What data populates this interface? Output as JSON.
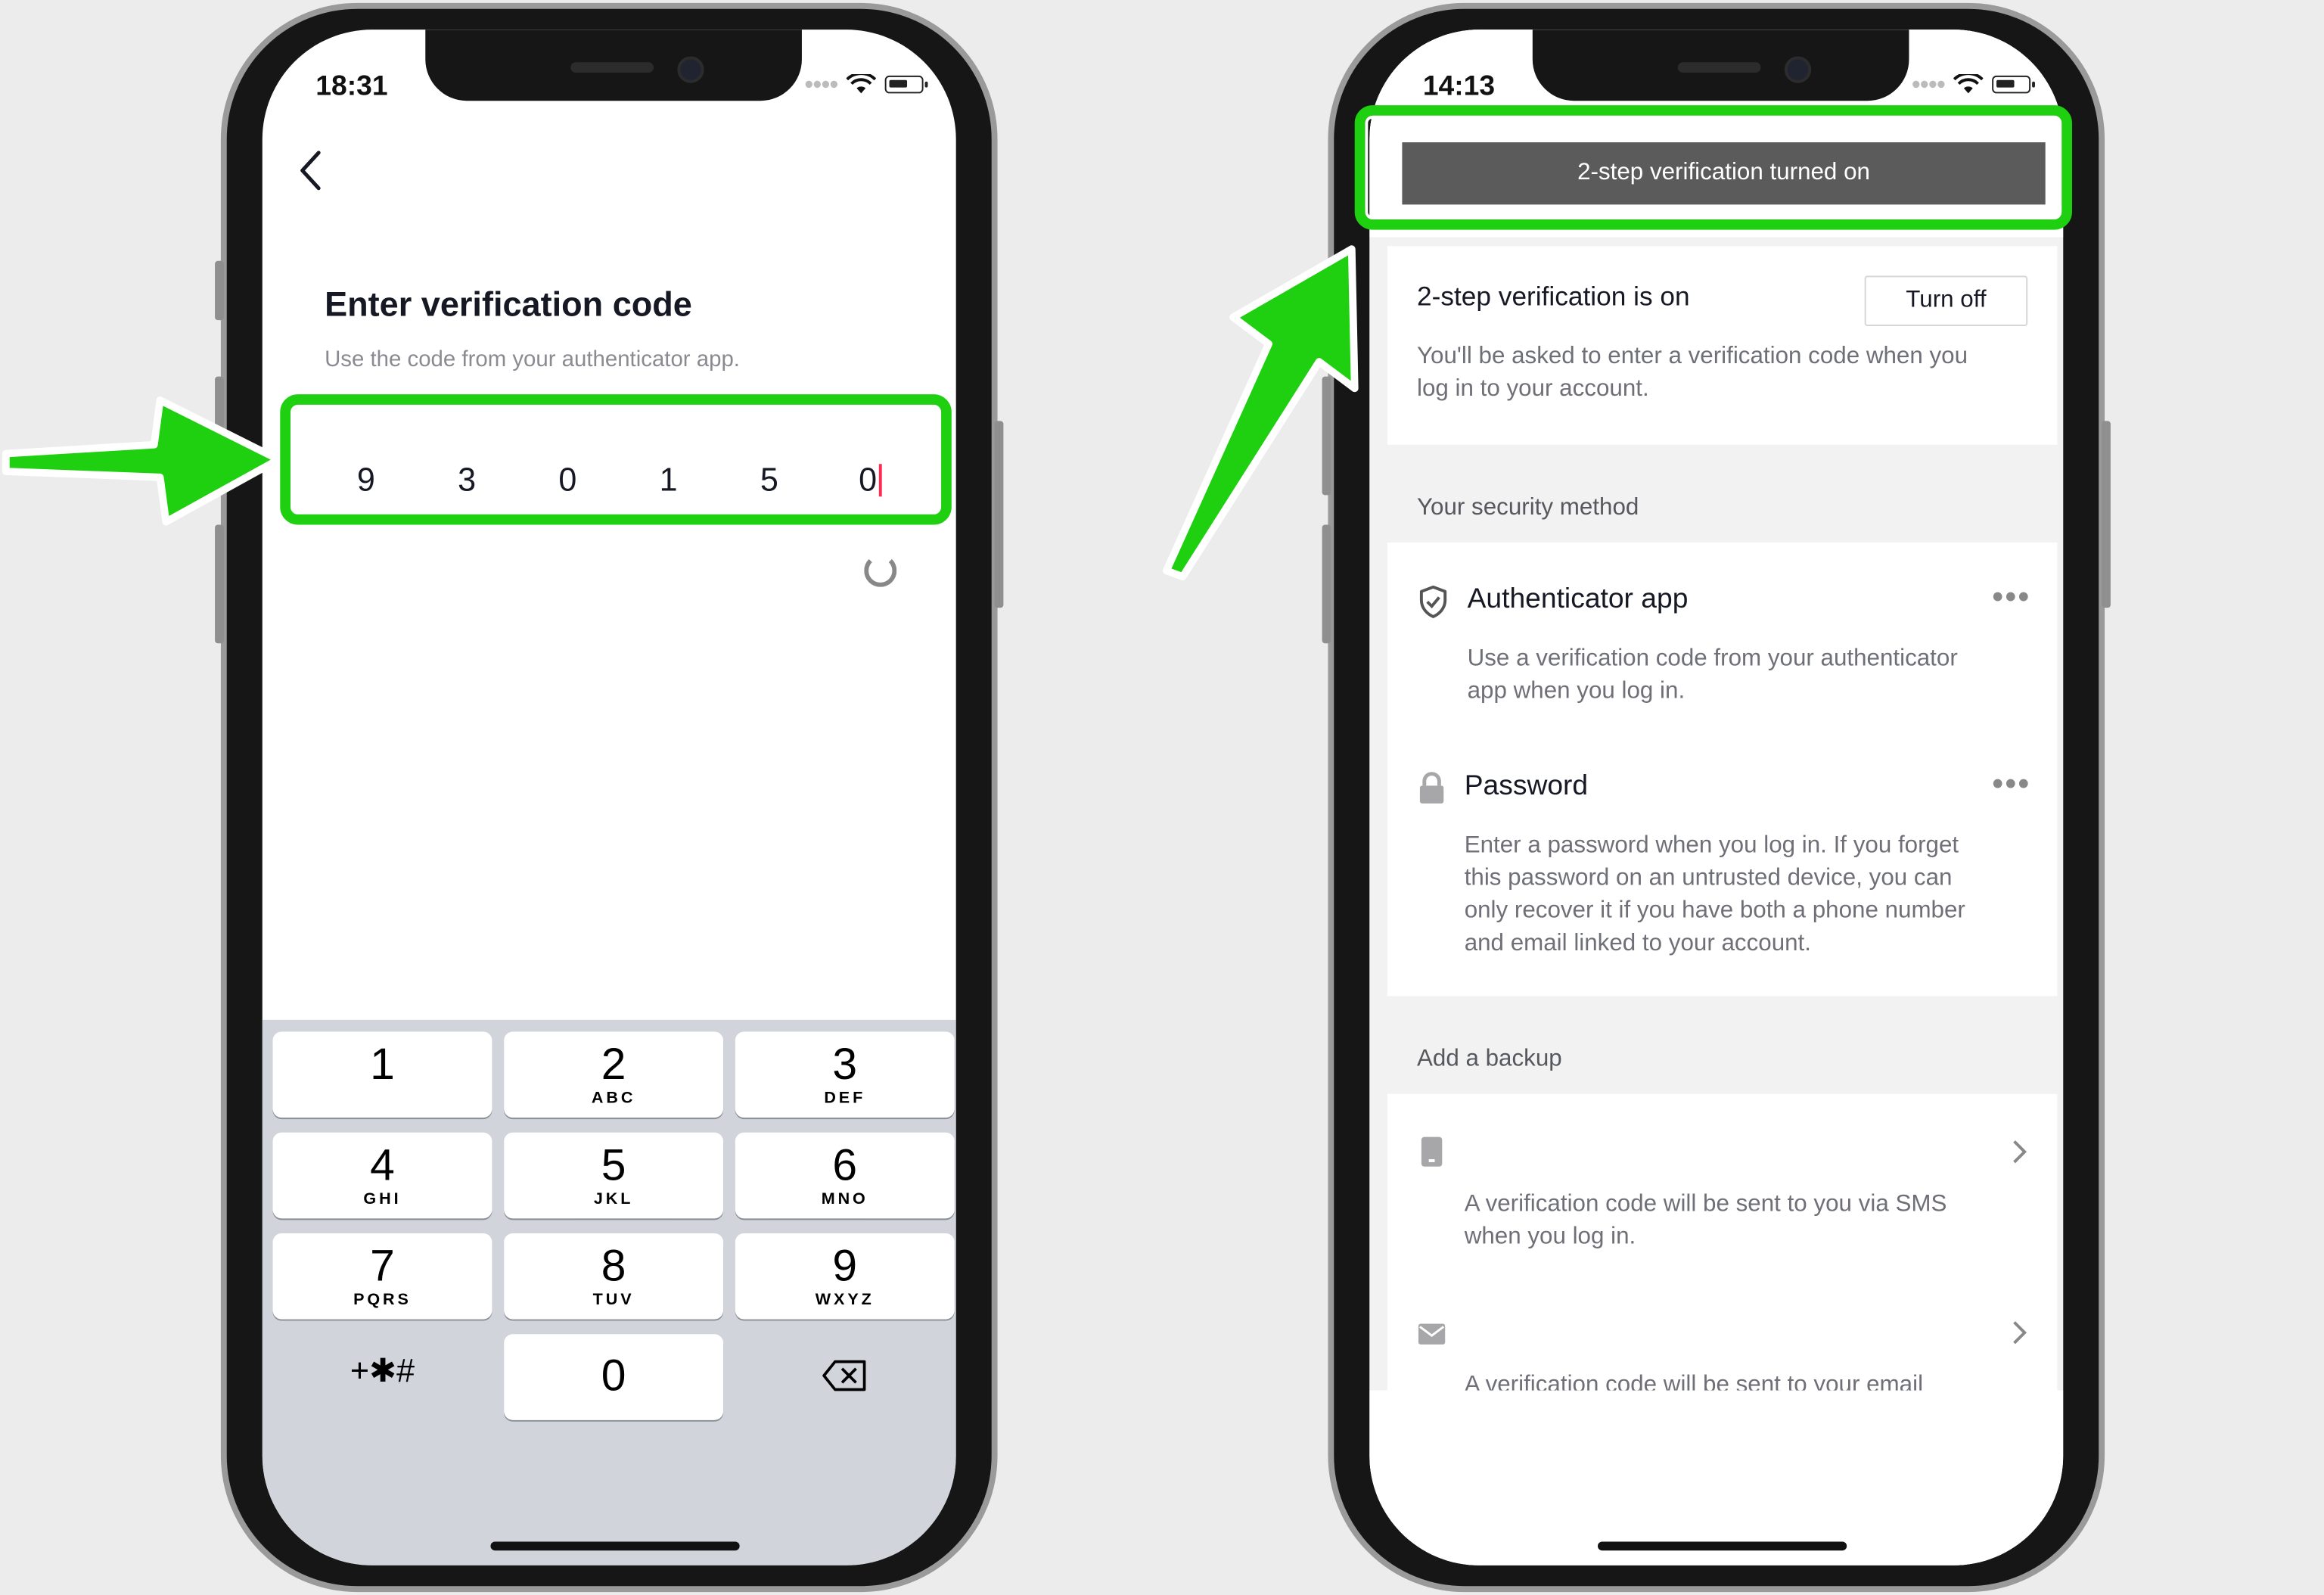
{
  "left_phone": {
    "status_time": "18:31",
    "title": "Enter verification code",
    "subtitle": "Use the code from your authenticator app.",
    "code_digits": [
      "9",
      "3",
      "0",
      "1",
      "5",
      "0"
    ],
    "keypad": [
      {
        "num": "1",
        "letters": ""
      },
      {
        "num": "2",
        "letters": "ABC"
      },
      {
        "num": "3",
        "letters": "DEF"
      },
      {
        "num": "4",
        "letters": "GHI"
      },
      {
        "num": "5",
        "letters": "JKL"
      },
      {
        "num": "6",
        "letters": "MNO"
      },
      {
        "num": "7",
        "letters": "PQRS"
      },
      {
        "num": "8",
        "letters": "TUV"
      },
      {
        "num": "9",
        "letters": "WXYZ"
      },
      {
        "num": "+✱#",
        "letters": ""
      },
      {
        "num": "0",
        "letters": ""
      }
    ]
  },
  "right_phone": {
    "status_time": "14:13",
    "toast": "2-step verification turned on",
    "status": {
      "heading": "2-step verification is on",
      "turn_off_label": "Turn off",
      "description_line1": "You'll be asked to enter a verification code when you",
      "description_line2": "log in to your account."
    },
    "security_method_label": "Your security method",
    "authenticator": {
      "title": "Authenticator app",
      "desc_line1": "Use a verification code from your authenticator",
      "desc_line2": "app when you log in."
    },
    "password": {
      "title": "Password",
      "desc_line1": "Enter a password when you log in. If you forget",
      "desc_line2": "this password on an untrusted device, you can",
      "desc_line3": "only recover it if you have both a phone number",
      "desc_line4": "and email linked to your account."
    },
    "backup_label": "Add a backup",
    "sms": {
      "desc_line1": "A verification code will be sent to you via SMS",
      "desc_line2": "when you log in."
    },
    "email": {
      "desc_partial": "A verification code will be sent to your email"
    }
  },
  "colors": {
    "highlight": "#1ed00f",
    "toast_bg": "#5b5b5b",
    "caret": "#fe2c55"
  }
}
